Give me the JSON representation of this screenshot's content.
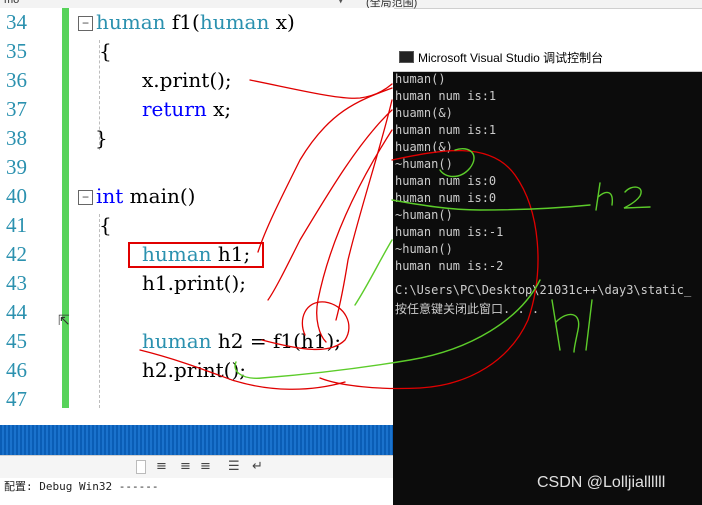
{
  "topbar": {
    "left_text": "mo",
    "scope_text": "(全局范围)"
  },
  "editor": {
    "line_numbers": [
      "34",
      "35",
      "36",
      "37",
      "38",
      "39",
      "40",
      "41",
      "42",
      "43",
      "44",
      "45",
      "46",
      "47"
    ],
    "code": {
      "l34_type": "human",
      "l34_rest": " f1(",
      "l34_param_type": "human",
      "l34_param": " x)",
      "l35": "{",
      "l36": "x.print();",
      "l37_kw": "return",
      "l37_rest": " x;",
      "l38": "}",
      "l40_kw": "int",
      "l40_rest": " main()",
      "l41": "{",
      "l42_type": "human",
      "l42_rest": " h1;",
      "l43": "h1.print();",
      "l45_type": "human",
      "l45_rest": " h2 = f1(h1);",
      "l46": "h2.print();"
    }
  },
  "output_panel": {
    "status_text": "配置: Debug Win32 ------"
  },
  "console": {
    "title": "Microsoft Visual Studio 调试控制台",
    "lines": [
      "human()",
      "human num is:1",
      "huamn(&)",
      "human num is:1",
      "huamn(&)",
      "~human()",
      "human num is:0",
      "human num is:0",
      "~human()",
      "human num is:-1",
      "~human()",
      "human num is:-2",
      "",
      "C:\\Users\\PC\\Desktop\\21031c++\\day3\\static_",
      "按任意键关闭此窗口. . ."
    ]
  },
  "annotations": {
    "h2": "h2",
    "h1": "h1"
  },
  "watermark": "CSDN @Lolljiallllll",
  "colors": {
    "keyword": "#0000ff",
    "type": "#2b91af",
    "ink_red": "#e00000",
    "ink_green": "#5ccc2a"
  }
}
